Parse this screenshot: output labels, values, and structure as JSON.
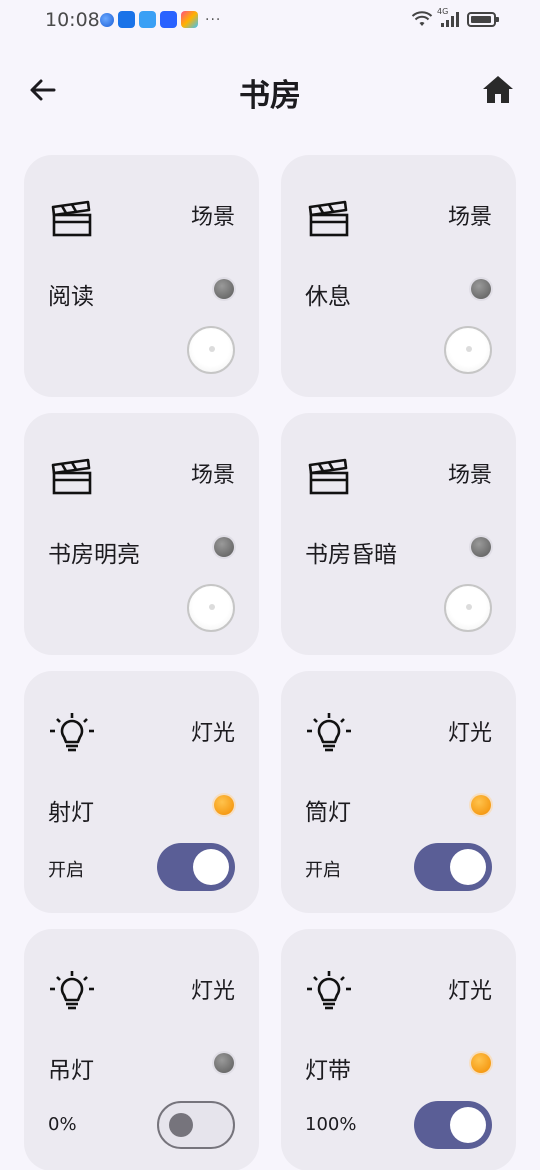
{
  "status_bar": {
    "time": "10:08",
    "more": "···",
    "network": "4G"
  },
  "header": {
    "title": "书房"
  },
  "cards": [
    {
      "type": "场景",
      "icon": "clapperboard-icon",
      "name": "阅读",
      "indicator": "off",
      "control": "button"
    },
    {
      "type": "场景",
      "icon": "clapperboard-icon",
      "name": "休息",
      "indicator": "off",
      "control": "button"
    },
    {
      "type": "场景",
      "icon": "clapperboard-icon",
      "name": "书房明亮",
      "indicator": "off",
      "control": "button"
    },
    {
      "type": "场景",
      "icon": "clapperboard-icon",
      "name": "书房昏暗",
      "indicator": "off",
      "control": "button"
    },
    {
      "type": "灯光",
      "icon": "light-bulb-icon",
      "name": "射灯",
      "indicator": "on",
      "status": "开启",
      "toggle": "on"
    },
    {
      "type": "灯光",
      "icon": "light-bulb-icon",
      "name": "筒灯",
      "indicator": "on",
      "status": "开启",
      "toggle": "on"
    },
    {
      "type": "灯光",
      "icon": "light-bulb-icon",
      "name": "吊灯",
      "indicator": "off",
      "status": "0%",
      "toggle": "off"
    },
    {
      "type": "灯光",
      "icon": "light-bulb-icon",
      "name": "灯带",
      "indicator": "on",
      "status": "100%",
      "toggle": "on"
    }
  ],
  "colors": {
    "background": "#f7f5fc",
    "card": "#eceaf1",
    "accent": "#5a5e96",
    "indicator_on": "#f28c00",
    "indicator_off": "#5a5a5a"
  }
}
